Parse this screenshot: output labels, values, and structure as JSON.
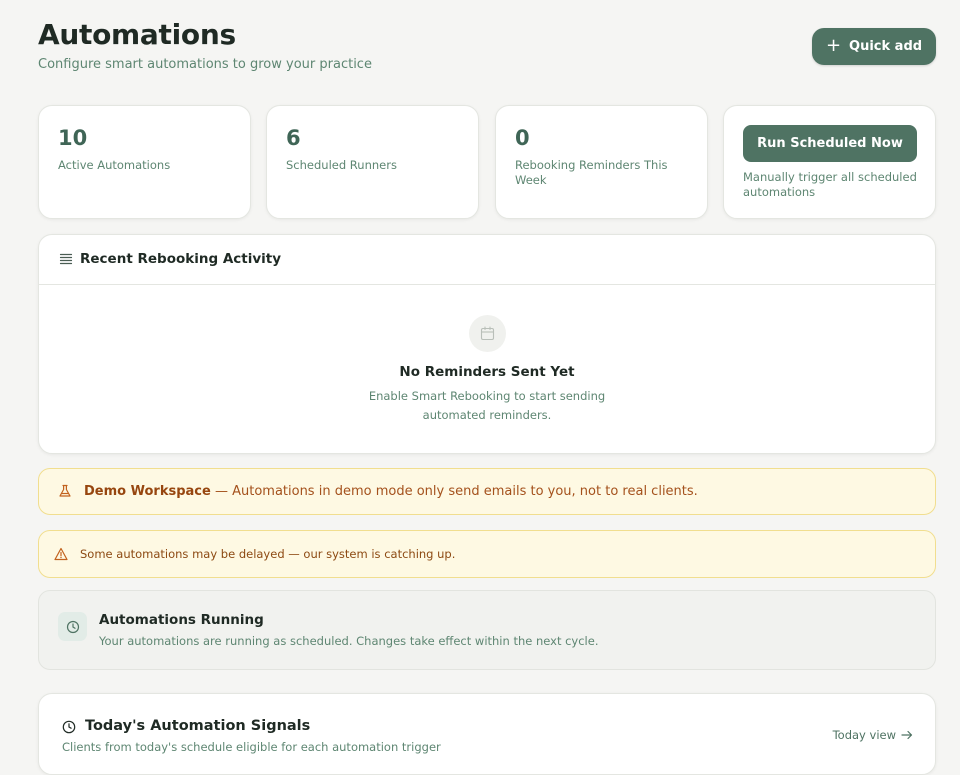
{
  "header": {
    "title": "Automations",
    "subtitle": "Configure smart automations to grow your practice",
    "quick_add_label": "Quick add"
  },
  "stats": [
    {
      "value": "10",
      "label": "Active Automations"
    },
    {
      "value": "6",
      "label": "Scheduled Runners"
    },
    {
      "value": "0",
      "label": "Rebooking Reminders This Week"
    }
  ],
  "run_card": {
    "button_label": "Run Scheduled Now",
    "hint": "Manually trigger all scheduled automations"
  },
  "recent_activity": {
    "title": "Recent Rebooking Activity",
    "empty_title": "No Reminders Sent Yet",
    "empty_desc": "Enable Smart Rebooking to start sending automated reminders."
  },
  "demo_banner": {
    "strong": "Demo Workspace",
    "text": " — Automations in demo mode only send emails to you, not to real clients."
  },
  "delay_banner": {
    "text": "Some automations may be delayed — our system is catching up."
  },
  "running": {
    "title": "Automations Running",
    "desc": "Your automations are running as scheduled. Changes take effect within the next cycle."
  },
  "signals": {
    "title": "Today's Automation Signals",
    "subtitle": "Clients from today's schedule eligible for each automation trigger",
    "link_label": "Today view"
  },
  "colors": {
    "accent": "#4f7363",
    "muted_text": "#5e8672",
    "warning_bg": "#fef9e3",
    "warning_border": "#f1de8f",
    "warning_text": "#a4511c"
  },
  "icons": {
    "quick_add": "plus-icon",
    "recent_activity": "list-icon",
    "empty_state": "calendar-icon",
    "demo": "flask-icon",
    "delay": "warning-triangle-icon",
    "running": "clock-icon",
    "signals": "clock-icon",
    "link": "arrow-right-icon"
  }
}
